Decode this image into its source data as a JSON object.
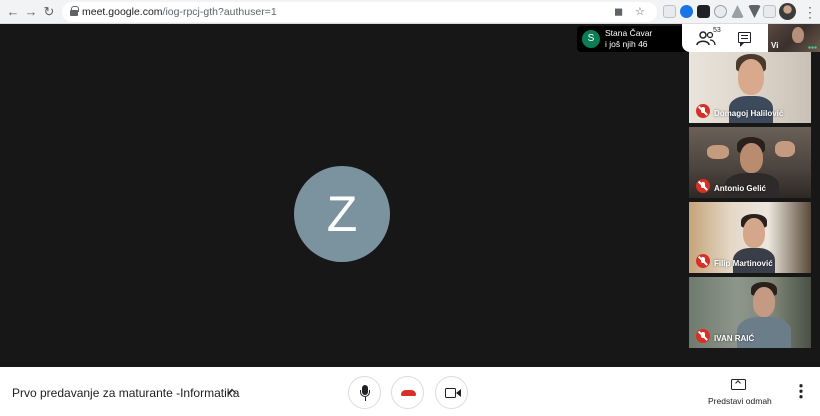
{
  "browser": {
    "url_host": "meet.google.com",
    "url_path": "/iog-rpcj-gth?authuser=1",
    "back_icon": "arrow-left-icon",
    "forward_icon": "arrow-right-icon",
    "reload_icon": "reload-icon"
  },
  "stage": {
    "main_avatar_letter": "Z",
    "main_avatar_color": "#7b939e"
  },
  "participants_chip": {
    "avatar_letter": "S",
    "name": "Stana Čavar",
    "others": "i još njih 46"
  },
  "toolbar": {
    "people_count": "53",
    "self_label": "Vi"
  },
  "tiles": [
    {
      "name": "Domagoj Halilović"
    },
    {
      "name": "Antonio Gelić"
    },
    {
      "name": "Filip Martinović"
    },
    {
      "name": "IVAN RAIĆ"
    }
  ],
  "bottom_bar": {
    "meeting_title": "Prvo predavanje za maturante -Informatika",
    "present_label": "Predstavi odmah"
  },
  "colors": {
    "stage_bg": "#171717",
    "hangup_red": "#d93025",
    "mic_off_red": "#d93025",
    "chip_avatar_green": "#0a7d57"
  }
}
